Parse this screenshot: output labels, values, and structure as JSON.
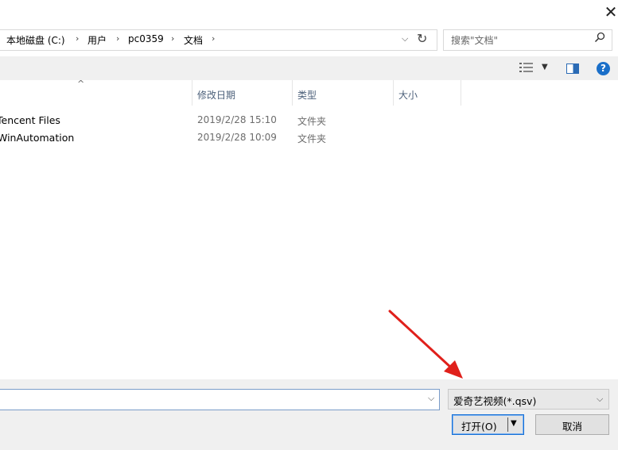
{
  "window": {
    "close_glyph": "✕"
  },
  "address_bar": {
    "crumbs": [
      "本地磁盘 (C:)",
      "用户",
      "pc0359",
      "文档"
    ],
    "separator": "›",
    "dropdown_glyph": "⌵",
    "refresh_glyph": "↻"
  },
  "search": {
    "placeholder": "搜索\"文档\"",
    "icon": "search-icon"
  },
  "toolbar": {
    "view_icon": "details-view-icon",
    "view_dropdown_glyph": "▼",
    "help_label": "?"
  },
  "columns": {
    "name_sort_glyph": "^",
    "date": "修改日期",
    "type": "类型",
    "size": "大小"
  },
  "files": [
    {
      "name": "Tencent Files",
      "date": "2019/2/28 15:10",
      "type": "文件夹",
      "size": ""
    },
    {
      "name": "WinAutomation",
      "date": "2019/2/28 10:09",
      "type": "文件夹",
      "size": ""
    }
  ],
  "filename_input": {
    "value": "",
    "dropdown_glyph": "⌵"
  },
  "filetype_select": {
    "selected": "爱奇艺视频(*.qsv)",
    "dropdown_glyph": "⌵"
  },
  "buttons": {
    "open": "打开(O)",
    "open_dropdown_glyph": "▼",
    "cancel": "取消"
  },
  "annotation": {
    "arrow_color": "#e0201b"
  }
}
